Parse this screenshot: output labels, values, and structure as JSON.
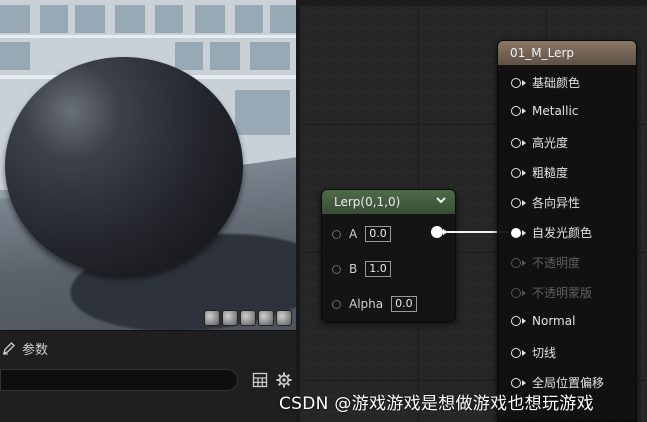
{
  "viewport": {
    "label": "Material preview viewport"
  },
  "details": {
    "tab_label": "参数",
    "search_placeholder": ""
  },
  "lerp_node": {
    "title": "Lerp(0,1,0)",
    "inputs": [
      {
        "label": "A",
        "value": "0.0"
      },
      {
        "label": "B",
        "value": "1.0"
      },
      {
        "label": "Alpha",
        "value": "0.0"
      }
    ]
  },
  "material_node": {
    "title": "01_M_Lerp",
    "pins": [
      {
        "label": "基础颜色",
        "enabled": true,
        "connected": false
      },
      {
        "label": "Metallic",
        "enabled": true,
        "connected": false
      },
      {
        "label": "高光度",
        "enabled": true,
        "connected": false
      },
      {
        "label": "粗糙度",
        "enabled": true,
        "connected": false
      },
      {
        "label": "各向异性",
        "enabled": true,
        "connected": false
      },
      {
        "label": "自发光颜色",
        "enabled": true,
        "connected": true
      },
      {
        "label": "不透明度",
        "enabled": false,
        "connected": false
      },
      {
        "label": "不透明蒙版",
        "enabled": false,
        "connected": false
      },
      {
        "label": "Normal",
        "enabled": true,
        "connected": false
      },
      {
        "label": "切线",
        "enabled": true,
        "connected": false
      },
      {
        "label": "全局位置偏移",
        "enabled": true,
        "connected": false
      }
    ]
  },
  "watermark": "CSDN @游戏游戏是想做游戏也想玩游戏",
  "colors": {
    "lerp_header": "#4f6b4a",
    "material_header": "#8b7866",
    "graph_bg": "#262626"
  }
}
